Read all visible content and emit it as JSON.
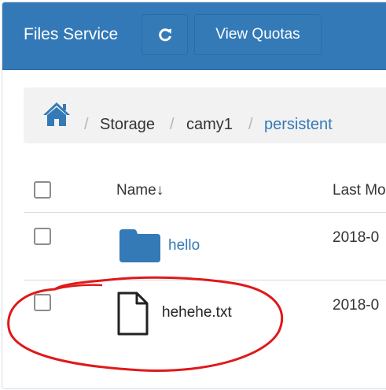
{
  "header": {
    "title": "Files Service",
    "refresh_icon": "refresh-icon",
    "view_quotas_label": "View Quotas"
  },
  "breadcrumb": {
    "home_icon": "home-icon",
    "items": [
      "Storage",
      "camy1",
      "persistent"
    ],
    "separator": "/"
  },
  "table": {
    "columns": [
      "Name",
      "Last Mo"
    ],
    "sort_indicator": "↓",
    "rows": [
      {
        "name": "hello",
        "type": "folder",
        "icon": "folder-icon",
        "modified": "2018-0"
      },
      {
        "name": "hehehe.txt",
        "type": "file",
        "icon": "file-icon",
        "modified": "2018-0"
      }
    ]
  },
  "colors": {
    "header_bg": "#3379b7",
    "link": "#337ab7",
    "folder": "#337ab7",
    "annotation": "#e0191a"
  }
}
